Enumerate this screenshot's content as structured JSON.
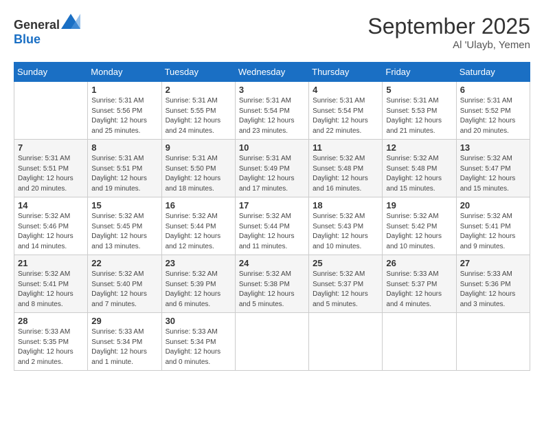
{
  "header": {
    "logo_general": "General",
    "logo_blue": "Blue",
    "month": "September 2025",
    "location": "Al 'Ulayb, Yemen"
  },
  "weekdays": [
    "Sunday",
    "Monday",
    "Tuesday",
    "Wednesday",
    "Thursday",
    "Friday",
    "Saturday"
  ],
  "weeks": [
    [
      {
        "day": "",
        "info": ""
      },
      {
        "day": "1",
        "info": "Sunrise: 5:31 AM\nSunset: 5:56 PM\nDaylight: 12 hours\nand 25 minutes."
      },
      {
        "day": "2",
        "info": "Sunrise: 5:31 AM\nSunset: 5:55 PM\nDaylight: 12 hours\nand 24 minutes."
      },
      {
        "day": "3",
        "info": "Sunrise: 5:31 AM\nSunset: 5:54 PM\nDaylight: 12 hours\nand 23 minutes."
      },
      {
        "day": "4",
        "info": "Sunrise: 5:31 AM\nSunset: 5:54 PM\nDaylight: 12 hours\nand 22 minutes."
      },
      {
        "day": "5",
        "info": "Sunrise: 5:31 AM\nSunset: 5:53 PM\nDaylight: 12 hours\nand 21 minutes."
      },
      {
        "day": "6",
        "info": "Sunrise: 5:31 AM\nSunset: 5:52 PM\nDaylight: 12 hours\nand 20 minutes."
      }
    ],
    [
      {
        "day": "7",
        "info": "Sunrise: 5:31 AM\nSunset: 5:51 PM\nDaylight: 12 hours\nand 20 minutes."
      },
      {
        "day": "8",
        "info": "Sunrise: 5:31 AM\nSunset: 5:51 PM\nDaylight: 12 hours\nand 19 minutes."
      },
      {
        "day": "9",
        "info": "Sunrise: 5:31 AM\nSunset: 5:50 PM\nDaylight: 12 hours\nand 18 minutes."
      },
      {
        "day": "10",
        "info": "Sunrise: 5:31 AM\nSunset: 5:49 PM\nDaylight: 12 hours\nand 17 minutes."
      },
      {
        "day": "11",
        "info": "Sunrise: 5:32 AM\nSunset: 5:48 PM\nDaylight: 12 hours\nand 16 minutes."
      },
      {
        "day": "12",
        "info": "Sunrise: 5:32 AM\nSunset: 5:48 PM\nDaylight: 12 hours\nand 15 minutes."
      },
      {
        "day": "13",
        "info": "Sunrise: 5:32 AM\nSunset: 5:47 PM\nDaylight: 12 hours\nand 15 minutes."
      }
    ],
    [
      {
        "day": "14",
        "info": "Sunrise: 5:32 AM\nSunset: 5:46 PM\nDaylight: 12 hours\nand 14 minutes."
      },
      {
        "day": "15",
        "info": "Sunrise: 5:32 AM\nSunset: 5:45 PM\nDaylight: 12 hours\nand 13 minutes."
      },
      {
        "day": "16",
        "info": "Sunrise: 5:32 AM\nSunset: 5:44 PM\nDaylight: 12 hours\nand 12 minutes."
      },
      {
        "day": "17",
        "info": "Sunrise: 5:32 AM\nSunset: 5:44 PM\nDaylight: 12 hours\nand 11 minutes."
      },
      {
        "day": "18",
        "info": "Sunrise: 5:32 AM\nSunset: 5:43 PM\nDaylight: 12 hours\nand 10 minutes."
      },
      {
        "day": "19",
        "info": "Sunrise: 5:32 AM\nSunset: 5:42 PM\nDaylight: 12 hours\nand 10 minutes."
      },
      {
        "day": "20",
        "info": "Sunrise: 5:32 AM\nSunset: 5:41 PM\nDaylight: 12 hours\nand 9 minutes."
      }
    ],
    [
      {
        "day": "21",
        "info": "Sunrise: 5:32 AM\nSunset: 5:41 PM\nDaylight: 12 hours\nand 8 minutes."
      },
      {
        "day": "22",
        "info": "Sunrise: 5:32 AM\nSunset: 5:40 PM\nDaylight: 12 hours\nand 7 minutes."
      },
      {
        "day": "23",
        "info": "Sunrise: 5:32 AM\nSunset: 5:39 PM\nDaylight: 12 hours\nand 6 minutes."
      },
      {
        "day": "24",
        "info": "Sunrise: 5:32 AM\nSunset: 5:38 PM\nDaylight: 12 hours\nand 5 minutes."
      },
      {
        "day": "25",
        "info": "Sunrise: 5:32 AM\nSunset: 5:37 PM\nDaylight: 12 hours\nand 5 minutes."
      },
      {
        "day": "26",
        "info": "Sunrise: 5:33 AM\nSunset: 5:37 PM\nDaylight: 12 hours\nand 4 minutes."
      },
      {
        "day": "27",
        "info": "Sunrise: 5:33 AM\nSunset: 5:36 PM\nDaylight: 12 hours\nand 3 minutes."
      }
    ],
    [
      {
        "day": "28",
        "info": "Sunrise: 5:33 AM\nSunset: 5:35 PM\nDaylight: 12 hours\nand 2 minutes."
      },
      {
        "day": "29",
        "info": "Sunrise: 5:33 AM\nSunset: 5:34 PM\nDaylight: 12 hours\nand 1 minute."
      },
      {
        "day": "30",
        "info": "Sunrise: 5:33 AM\nSunset: 5:34 PM\nDaylight: 12 hours\nand 0 minutes."
      },
      {
        "day": "",
        "info": ""
      },
      {
        "day": "",
        "info": ""
      },
      {
        "day": "",
        "info": ""
      },
      {
        "day": "",
        "info": ""
      }
    ]
  ]
}
